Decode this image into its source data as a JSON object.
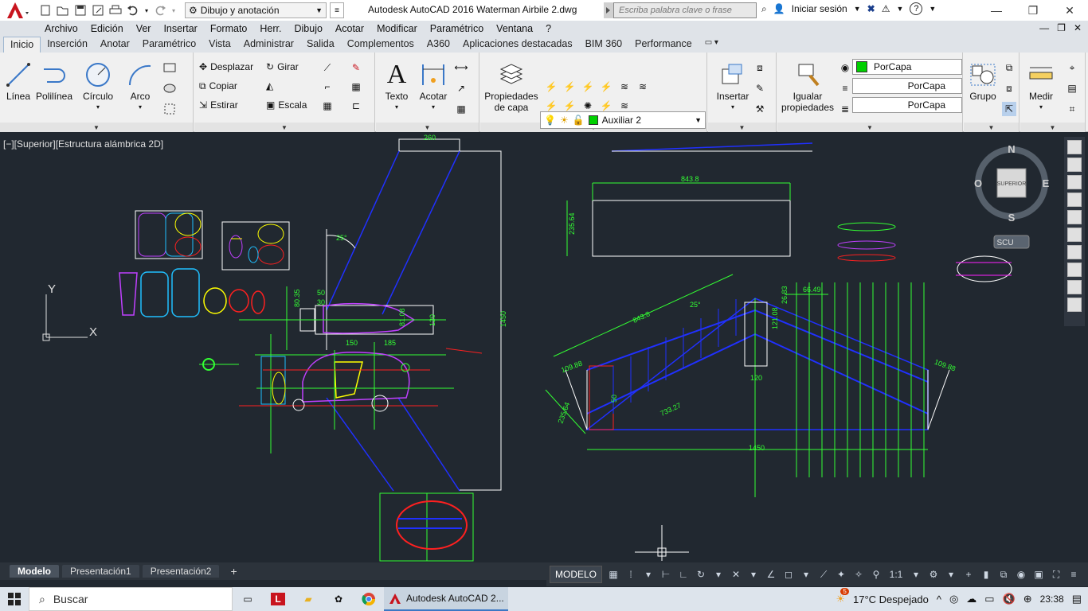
{
  "titlebar": {
    "workspace": "Dibujo y anotación",
    "title": "Autodesk AutoCAD 2016   Waterman Airbile 2.dwg",
    "search_placeholder": "Escriba palabra clave o frase",
    "signin": "Iniciar sesión"
  },
  "menu": [
    "Archivo",
    "Edición",
    "Ver",
    "Insertar",
    "Formato",
    "Herr.",
    "Dibujo",
    "Acotar",
    "Modificar",
    "Paramétrico",
    "Ventana",
    "?"
  ],
  "tabs": [
    "Inicio",
    "Inserción",
    "Anotar",
    "Paramétrico",
    "Vista",
    "Administrar",
    "Salida",
    "Complementos",
    "A360",
    "Aplicaciones destacadas",
    "BIM 360",
    "Performance"
  ],
  "ribbon": {
    "draw": {
      "line": "Línea",
      "polyline": "Polilínea",
      "circle": "Círculo",
      "arc": "Arco"
    },
    "modify": {
      "move": "Desplazar",
      "rotate": "Girar",
      "copy": "Copiar",
      "stretch": "Estirar",
      "scale": "Escala"
    },
    "annotation": {
      "text": "Texto",
      "dimension": "Acotar"
    },
    "layers": {
      "props_l1": "Propiedades",
      "props_l2": "de capa",
      "current_layer": "Auxiliar 2"
    },
    "block": {
      "insert": "Insertar"
    },
    "properties": {
      "match_l1": "Igualar",
      "match_l2": "propiedades",
      "color": "PorCapa",
      "linetype": "PorCapa",
      "lineweight": "PorCapa"
    },
    "groups": {
      "group": "Grupo"
    },
    "utilities": {
      "measure": "Medir"
    }
  },
  "viewport": {
    "label": "[−][Superior][Estructura alámbrica 2D]",
    "viewcube": {
      "n": "N",
      "s": "S",
      "e": "E",
      "w": "O",
      "face": "SUPERIOR",
      "ucs": "SCU"
    }
  },
  "drawing": {
    "dims": [
      "260",
      "1450",
      "25°",
      "843.8",
      "235.64",
      "30",
      "50",
      "80.35",
      "120",
      "81.08",
      "150",
      "185",
      "843.8",
      "25°",
      "26.83",
      "66.49",
      "121.08",
      "109.88",
      "235.64",
      "733.27",
      "120",
      "1450",
      "109.88",
      "50"
    ],
    "axis_y": "Y",
    "axis_x": "X"
  },
  "layout_tabs": [
    "Modelo",
    "Presentación1",
    "Presentación2"
  ],
  "status": {
    "model": "MODELO",
    "scale": "1:1"
  },
  "taskbar": {
    "search": "Buscar",
    "app": "Autodesk AutoCAD 2...",
    "weather": "17°C  Despejado",
    "time": "23:38",
    "badge": "5"
  },
  "colors": {
    "accent_red": "#c8141e",
    "cad_bg": "#212830",
    "dim_green": "#33ff33"
  }
}
